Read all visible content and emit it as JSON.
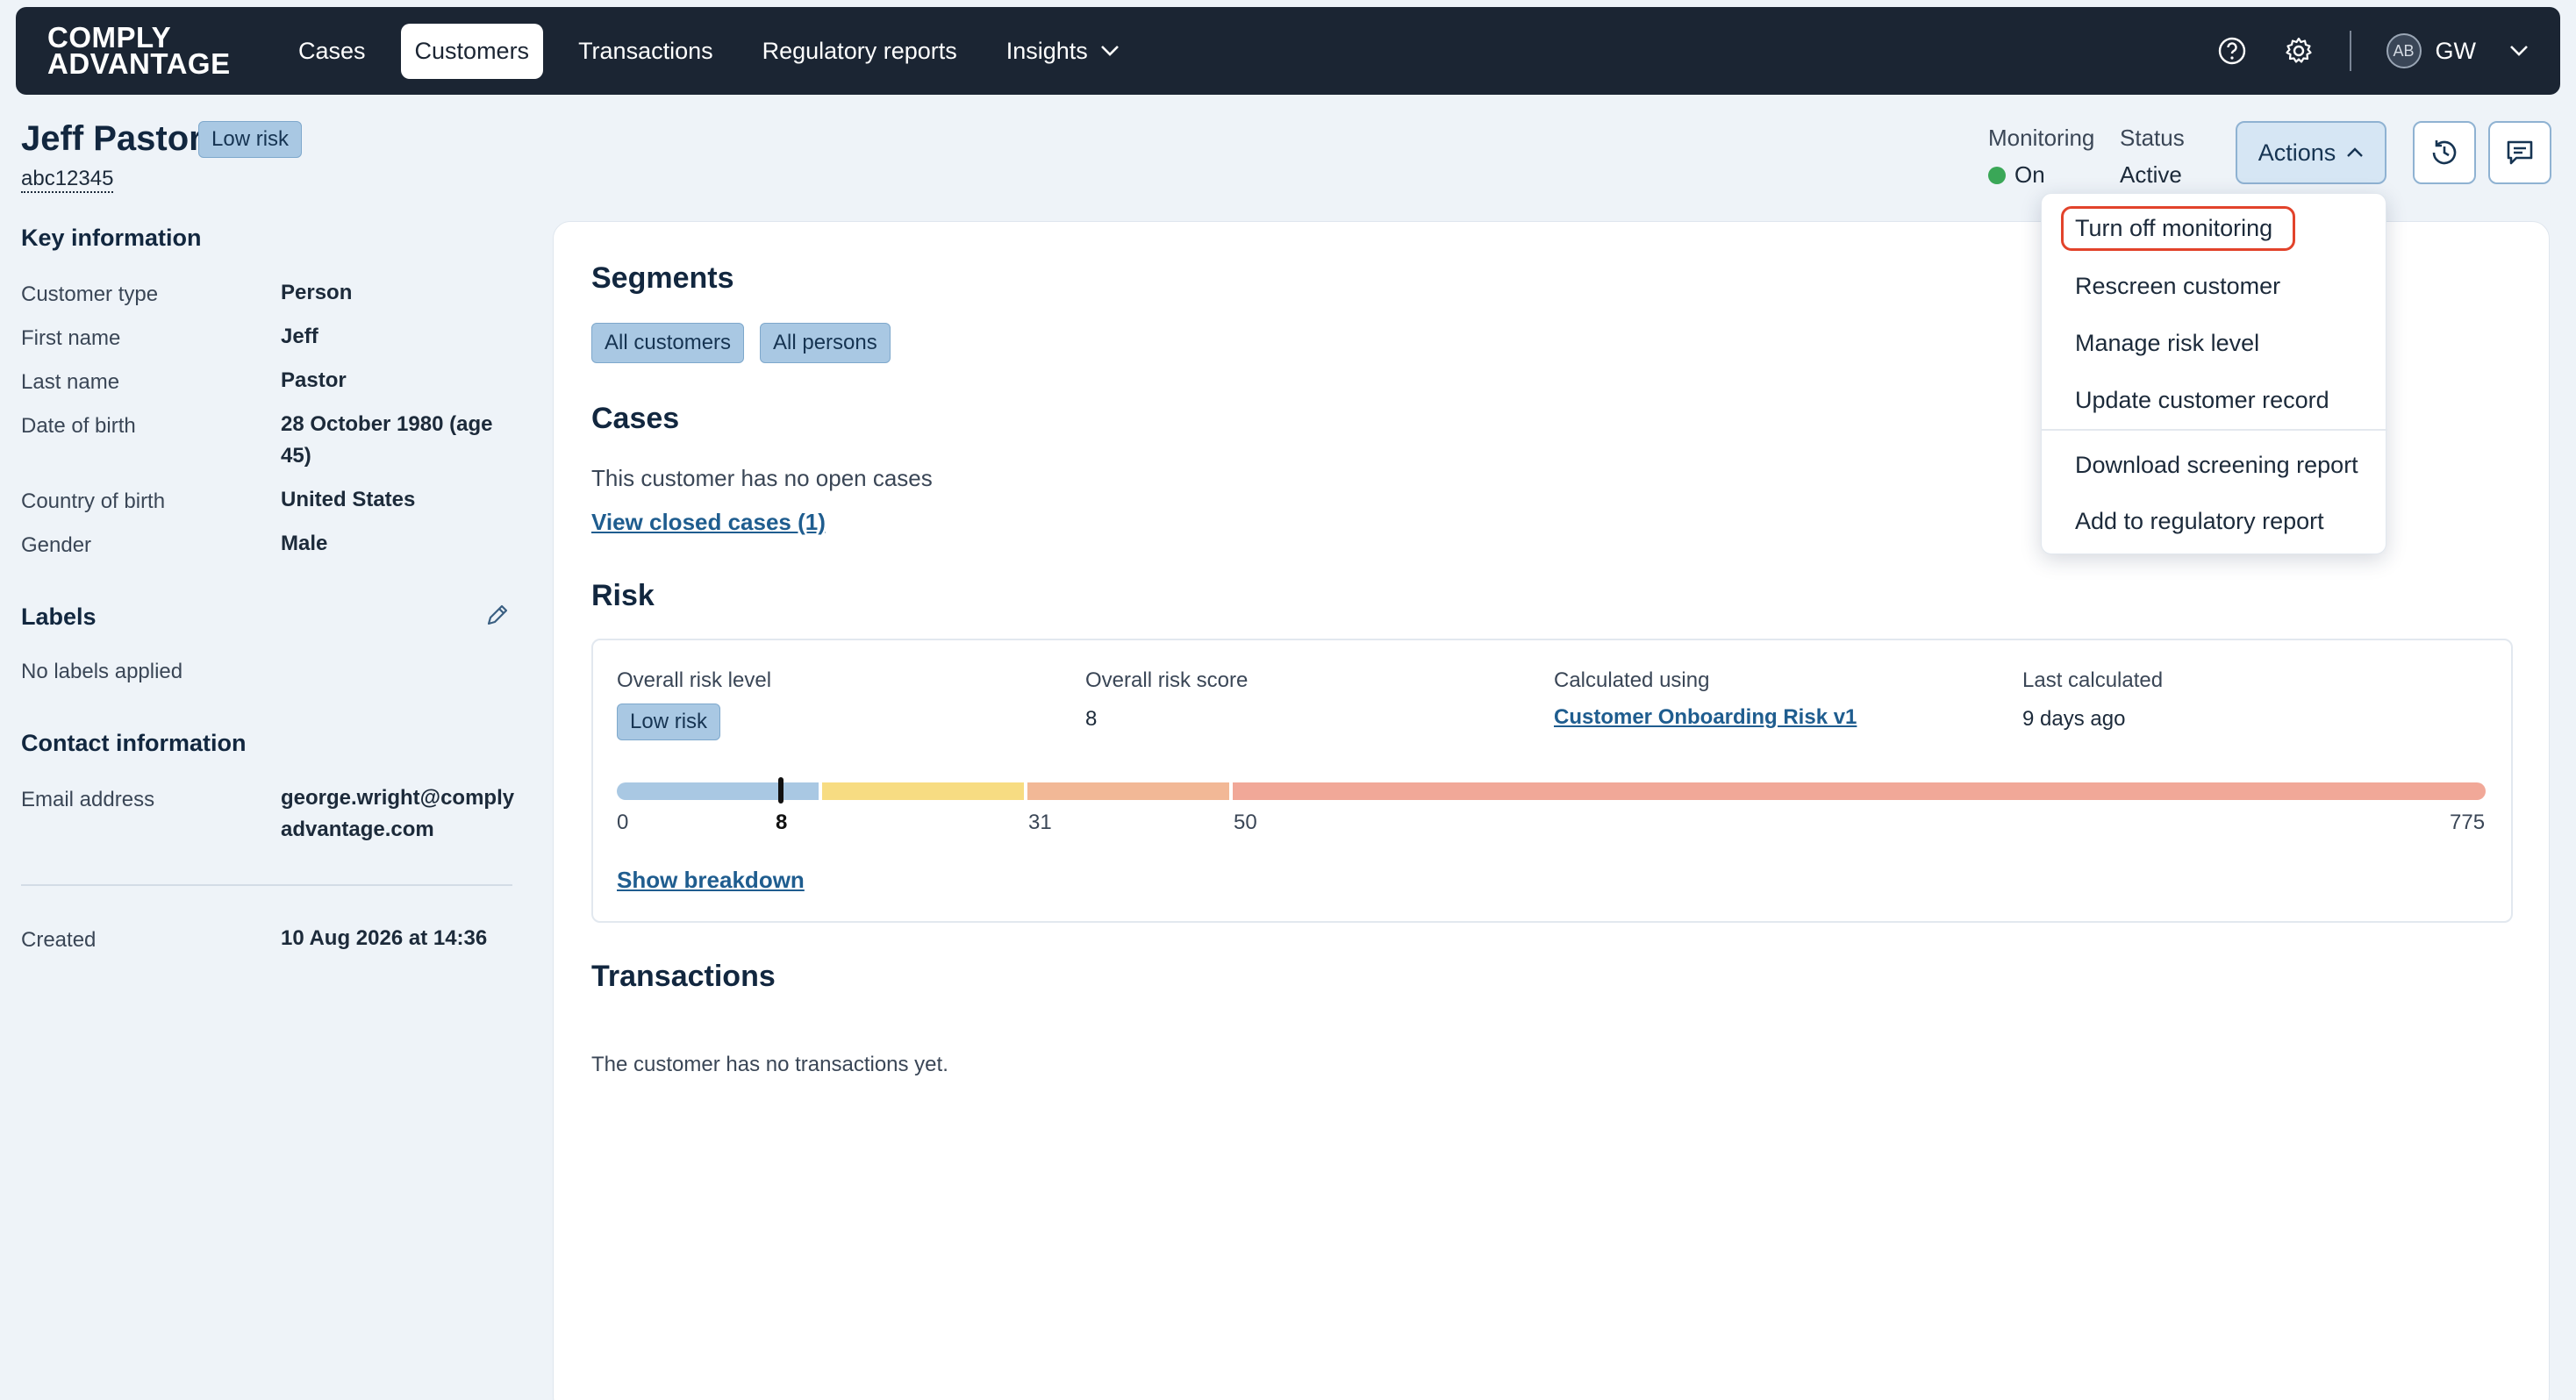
{
  "nav": {
    "logo_line1": "COMPLY",
    "logo_line2": "ADVANTAGE",
    "items": [
      {
        "label": "Cases"
      },
      {
        "label": "Customers"
      },
      {
        "label": "Transactions"
      },
      {
        "label": "Regulatory reports"
      },
      {
        "label": "Insights"
      }
    ],
    "user_initials": "AB",
    "user_short": "GW"
  },
  "header": {
    "name": "Jeff Pastor",
    "risk_badge": "Low risk",
    "customer_id": "abc12345",
    "monitoring_label": "Monitoring",
    "monitoring_value": "On",
    "status_label": "Status",
    "status_value": "Active",
    "actions_label": "Actions"
  },
  "actions_menu": {
    "items": [
      "Turn off monitoring",
      "Rescreen customer",
      "Manage risk level",
      "Update customer record",
      "Download screening report",
      "Add to regulatory report"
    ]
  },
  "key_info": {
    "title": "Key information",
    "rows": [
      {
        "label": "Customer type",
        "value": "Person"
      },
      {
        "label": "First name",
        "value": "Jeff"
      },
      {
        "label": "Last name",
        "value": "Pastor"
      },
      {
        "label": "Date of birth",
        "value": "28 October 1980 (age 45)"
      },
      {
        "label": "Country of birth",
        "value": "United States"
      },
      {
        "label": "Gender",
        "value": "Male"
      }
    ]
  },
  "labels": {
    "title": "Labels",
    "empty": "No labels applied"
  },
  "contact": {
    "title": "Contact information",
    "email_label": "Email address",
    "email_value": "george.wright@complyadvantage.com"
  },
  "created": {
    "label": "Created",
    "value": "10 Aug 2026 at 14:36"
  },
  "segments": {
    "title": "Segments",
    "items": [
      "All customers",
      "All persons"
    ]
  },
  "cases": {
    "title": "Cases",
    "empty": "This customer has no open cases",
    "closed_link": "View closed cases (1)"
  },
  "risk": {
    "title": "Risk",
    "overall_level_label": "Overall risk level",
    "overall_level_value": "Low risk",
    "overall_score_label": "Overall risk score",
    "overall_score_value": "8",
    "calculated_using_label": "Calculated using",
    "calculated_using_value": "Customer Onboarding Risk v1",
    "last_calculated_label": "Last calculated",
    "last_calculated_value": "9 days ago",
    "ticks": [
      "0",
      "8",
      "31",
      "50",
      "775"
    ],
    "scale": {
      "min": 0,
      "max": 775,
      "score": 8,
      "thresholds": [
        0,
        31,
        50
      ]
    },
    "colors": {
      "low": "#a9c8e3",
      "medium": "#f7dc82",
      "high": "#f2b896",
      "very_high": "#f1a898"
    },
    "show_breakdown": "Show breakdown"
  },
  "transactions": {
    "title": "Transactions",
    "empty": "The customer has no transactions yet."
  }
}
